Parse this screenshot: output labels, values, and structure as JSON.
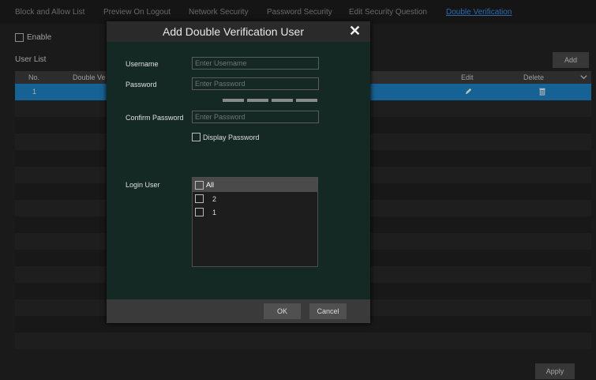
{
  "tabs": [
    "Block and Allow List",
    "Preview On Logout",
    "Network Security",
    "Password Security",
    "Edit Security Question",
    "Double Verification"
  ],
  "active_tab": "Double Verification",
  "enable_label": "Enable",
  "user_list_label": "User List",
  "add_label": "Add",
  "apply_label": "Apply",
  "table": {
    "columns": [
      "No.",
      "Double Ve",
      "Edit",
      "Delete"
    ],
    "rows": [
      {
        "no": "1"
      }
    ]
  },
  "modal": {
    "title": "Add Double Verification User",
    "username_label": "Username",
    "username_placeholder": "Enter Username",
    "password_label": "Password",
    "password_placeholder": "Enter Password",
    "confirm_label": "Confirm Password",
    "confirm_placeholder": "Enter Password",
    "display_password_label": "Display Password",
    "login_user_label": "Login User",
    "login_users": {
      "all_label": "All",
      "items": [
        "2",
        "1"
      ]
    },
    "ok_label": "OK",
    "cancel_label": "Cancel"
  },
  "colors": {
    "accent": "#1f83c6",
    "active_tab": "#3a8ee6",
    "modal_bg": "#142824"
  }
}
